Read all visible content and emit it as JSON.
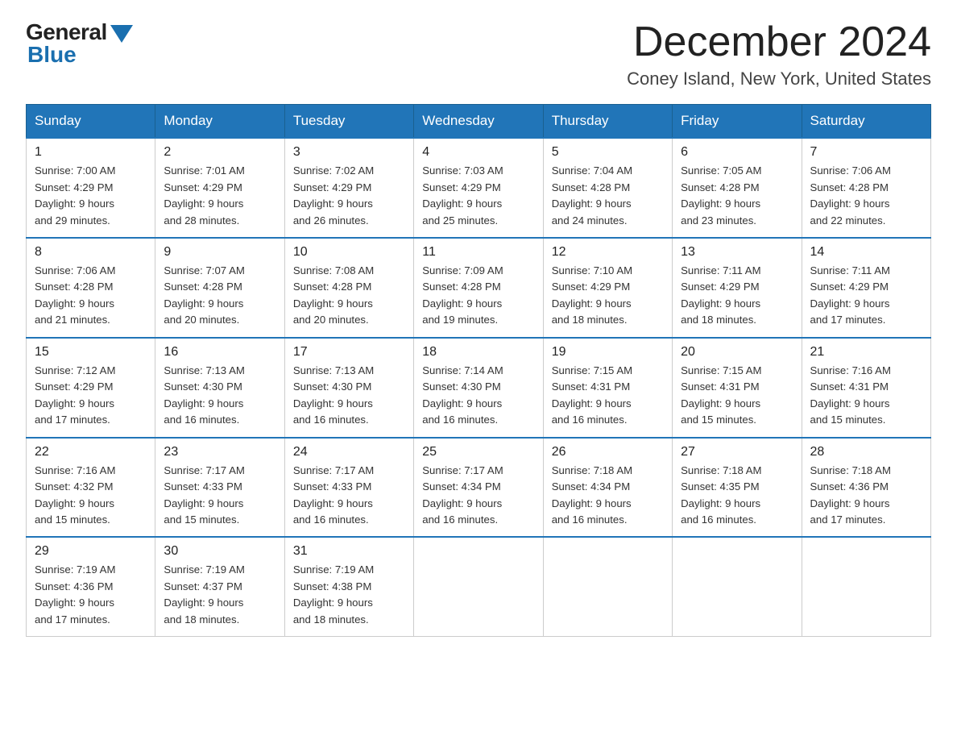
{
  "logo": {
    "general": "General",
    "blue": "Blue"
  },
  "title": {
    "month": "December 2024",
    "location": "Coney Island, New York, United States"
  },
  "weekdays": [
    "Sunday",
    "Monday",
    "Tuesday",
    "Wednesday",
    "Thursday",
    "Friday",
    "Saturday"
  ],
  "weeks": [
    [
      {
        "day": "1",
        "sunrise": "7:00 AM",
        "sunset": "4:29 PM",
        "daylight": "9 hours and 29 minutes."
      },
      {
        "day": "2",
        "sunrise": "7:01 AM",
        "sunset": "4:29 PM",
        "daylight": "9 hours and 28 minutes."
      },
      {
        "day": "3",
        "sunrise": "7:02 AM",
        "sunset": "4:29 PM",
        "daylight": "9 hours and 26 minutes."
      },
      {
        "day": "4",
        "sunrise": "7:03 AM",
        "sunset": "4:29 PM",
        "daylight": "9 hours and 25 minutes."
      },
      {
        "day": "5",
        "sunrise": "7:04 AM",
        "sunset": "4:28 PM",
        "daylight": "9 hours and 24 minutes."
      },
      {
        "day": "6",
        "sunrise": "7:05 AM",
        "sunset": "4:28 PM",
        "daylight": "9 hours and 23 minutes."
      },
      {
        "day": "7",
        "sunrise": "7:06 AM",
        "sunset": "4:28 PM",
        "daylight": "9 hours and 22 minutes."
      }
    ],
    [
      {
        "day": "8",
        "sunrise": "7:06 AM",
        "sunset": "4:28 PM",
        "daylight": "9 hours and 21 minutes."
      },
      {
        "day": "9",
        "sunrise": "7:07 AM",
        "sunset": "4:28 PM",
        "daylight": "9 hours and 20 minutes."
      },
      {
        "day": "10",
        "sunrise": "7:08 AM",
        "sunset": "4:28 PM",
        "daylight": "9 hours and 20 minutes."
      },
      {
        "day": "11",
        "sunrise": "7:09 AM",
        "sunset": "4:28 PM",
        "daylight": "9 hours and 19 minutes."
      },
      {
        "day": "12",
        "sunrise": "7:10 AM",
        "sunset": "4:29 PM",
        "daylight": "9 hours and 18 minutes."
      },
      {
        "day": "13",
        "sunrise": "7:11 AM",
        "sunset": "4:29 PM",
        "daylight": "9 hours and 18 minutes."
      },
      {
        "day": "14",
        "sunrise": "7:11 AM",
        "sunset": "4:29 PM",
        "daylight": "9 hours and 17 minutes."
      }
    ],
    [
      {
        "day": "15",
        "sunrise": "7:12 AM",
        "sunset": "4:29 PM",
        "daylight": "9 hours and 17 minutes."
      },
      {
        "day": "16",
        "sunrise": "7:13 AM",
        "sunset": "4:30 PM",
        "daylight": "9 hours and 16 minutes."
      },
      {
        "day": "17",
        "sunrise": "7:13 AM",
        "sunset": "4:30 PM",
        "daylight": "9 hours and 16 minutes."
      },
      {
        "day": "18",
        "sunrise": "7:14 AM",
        "sunset": "4:30 PM",
        "daylight": "9 hours and 16 minutes."
      },
      {
        "day": "19",
        "sunrise": "7:15 AM",
        "sunset": "4:31 PM",
        "daylight": "9 hours and 16 minutes."
      },
      {
        "day": "20",
        "sunrise": "7:15 AM",
        "sunset": "4:31 PM",
        "daylight": "9 hours and 15 minutes."
      },
      {
        "day": "21",
        "sunrise": "7:16 AM",
        "sunset": "4:31 PM",
        "daylight": "9 hours and 15 minutes."
      }
    ],
    [
      {
        "day": "22",
        "sunrise": "7:16 AM",
        "sunset": "4:32 PM",
        "daylight": "9 hours and 15 minutes."
      },
      {
        "day": "23",
        "sunrise": "7:17 AM",
        "sunset": "4:33 PM",
        "daylight": "9 hours and 15 minutes."
      },
      {
        "day": "24",
        "sunrise": "7:17 AM",
        "sunset": "4:33 PM",
        "daylight": "9 hours and 16 minutes."
      },
      {
        "day": "25",
        "sunrise": "7:17 AM",
        "sunset": "4:34 PM",
        "daylight": "9 hours and 16 minutes."
      },
      {
        "day": "26",
        "sunrise": "7:18 AM",
        "sunset": "4:34 PM",
        "daylight": "9 hours and 16 minutes."
      },
      {
        "day": "27",
        "sunrise": "7:18 AM",
        "sunset": "4:35 PM",
        "daylight": "9 hours and 16 minutes."
      },
      {
        "day": "28",
        "sunrise": "7:18 AM",
        "sunset": "4:36 PM",
        "daylight": "9 hours and 17 minutes."
      }
    ],
    [
      {
        "day": "29",
        "sunrise": "7:19 AM",
        "sunset": "4:36 PM",
        "daylight": "9 hours and 17 minutes."
      },
      {
        "day": "30",
        "sunrise": "7:19 AM",
        "sunset": "4:37 PM",
        "daylight": "9 hours and 18 minutes."
      },
      {
        "day": "31",
        "sunrise": "7:19 AM",
        "sunset": "4:38 PM",
        "daylight": "9 hours and 18 minutes."
      },
      null,
      null,
      null,
      null
    ]
  ]
}
